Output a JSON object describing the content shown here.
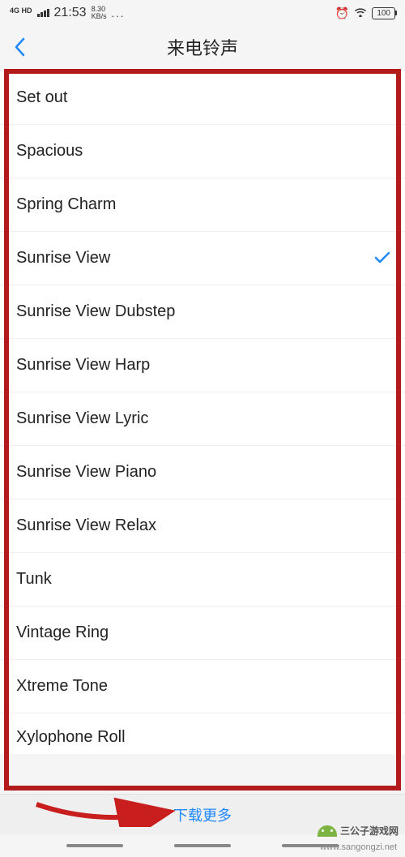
{
  "status": {
    "net_type": "4G HD",
    "time": "21:53",
    "speed_value": "8.30",
    "speed_unit": "KB/s",
    "dots": "...",
    "battery": "100"
  },
  "header": {
    "title": "来电铃声"
  },
  "ringtones": [
    {
      "name": "Set out",
      "selected": false
    },
    {
      "name": "Spacious",
      "selected": false
    },
    {
      "name": "Spring Charm",
      "selected": false
    },
    {
      "name": "Sunrise View",
      "selected": true
    },
    {
      "name": "Sunrise View Dubstep",
      "selected": false
    },
    {
      "name": "Sunrise View Harp",
      "selected": false
    },
    {
      "name": "Sunrise View Lyric",
      "selected": false
    },
    {
      "name": "Sunrise View Piano",
      "selected": false
    },
    {
      "name": "Sunrise View Relax",
      "selected": false
    },
    {
      "name": "Tunk",
      "selected": false
    },
    {
      "name": "Vintage Ring",
      "selected": false
    },
    {
      "name": "Xtreme Tone",
      "selected": false
    },
    {
      "name": "Xylophone Roll",
      "selected": false
    }
  ],
  "bottom": {
    "download_more": "下载更多"
  },
  "watermark": {
    "label": "三公子游戏网",
    "url": "www.sangongzi.net"
  }
}
